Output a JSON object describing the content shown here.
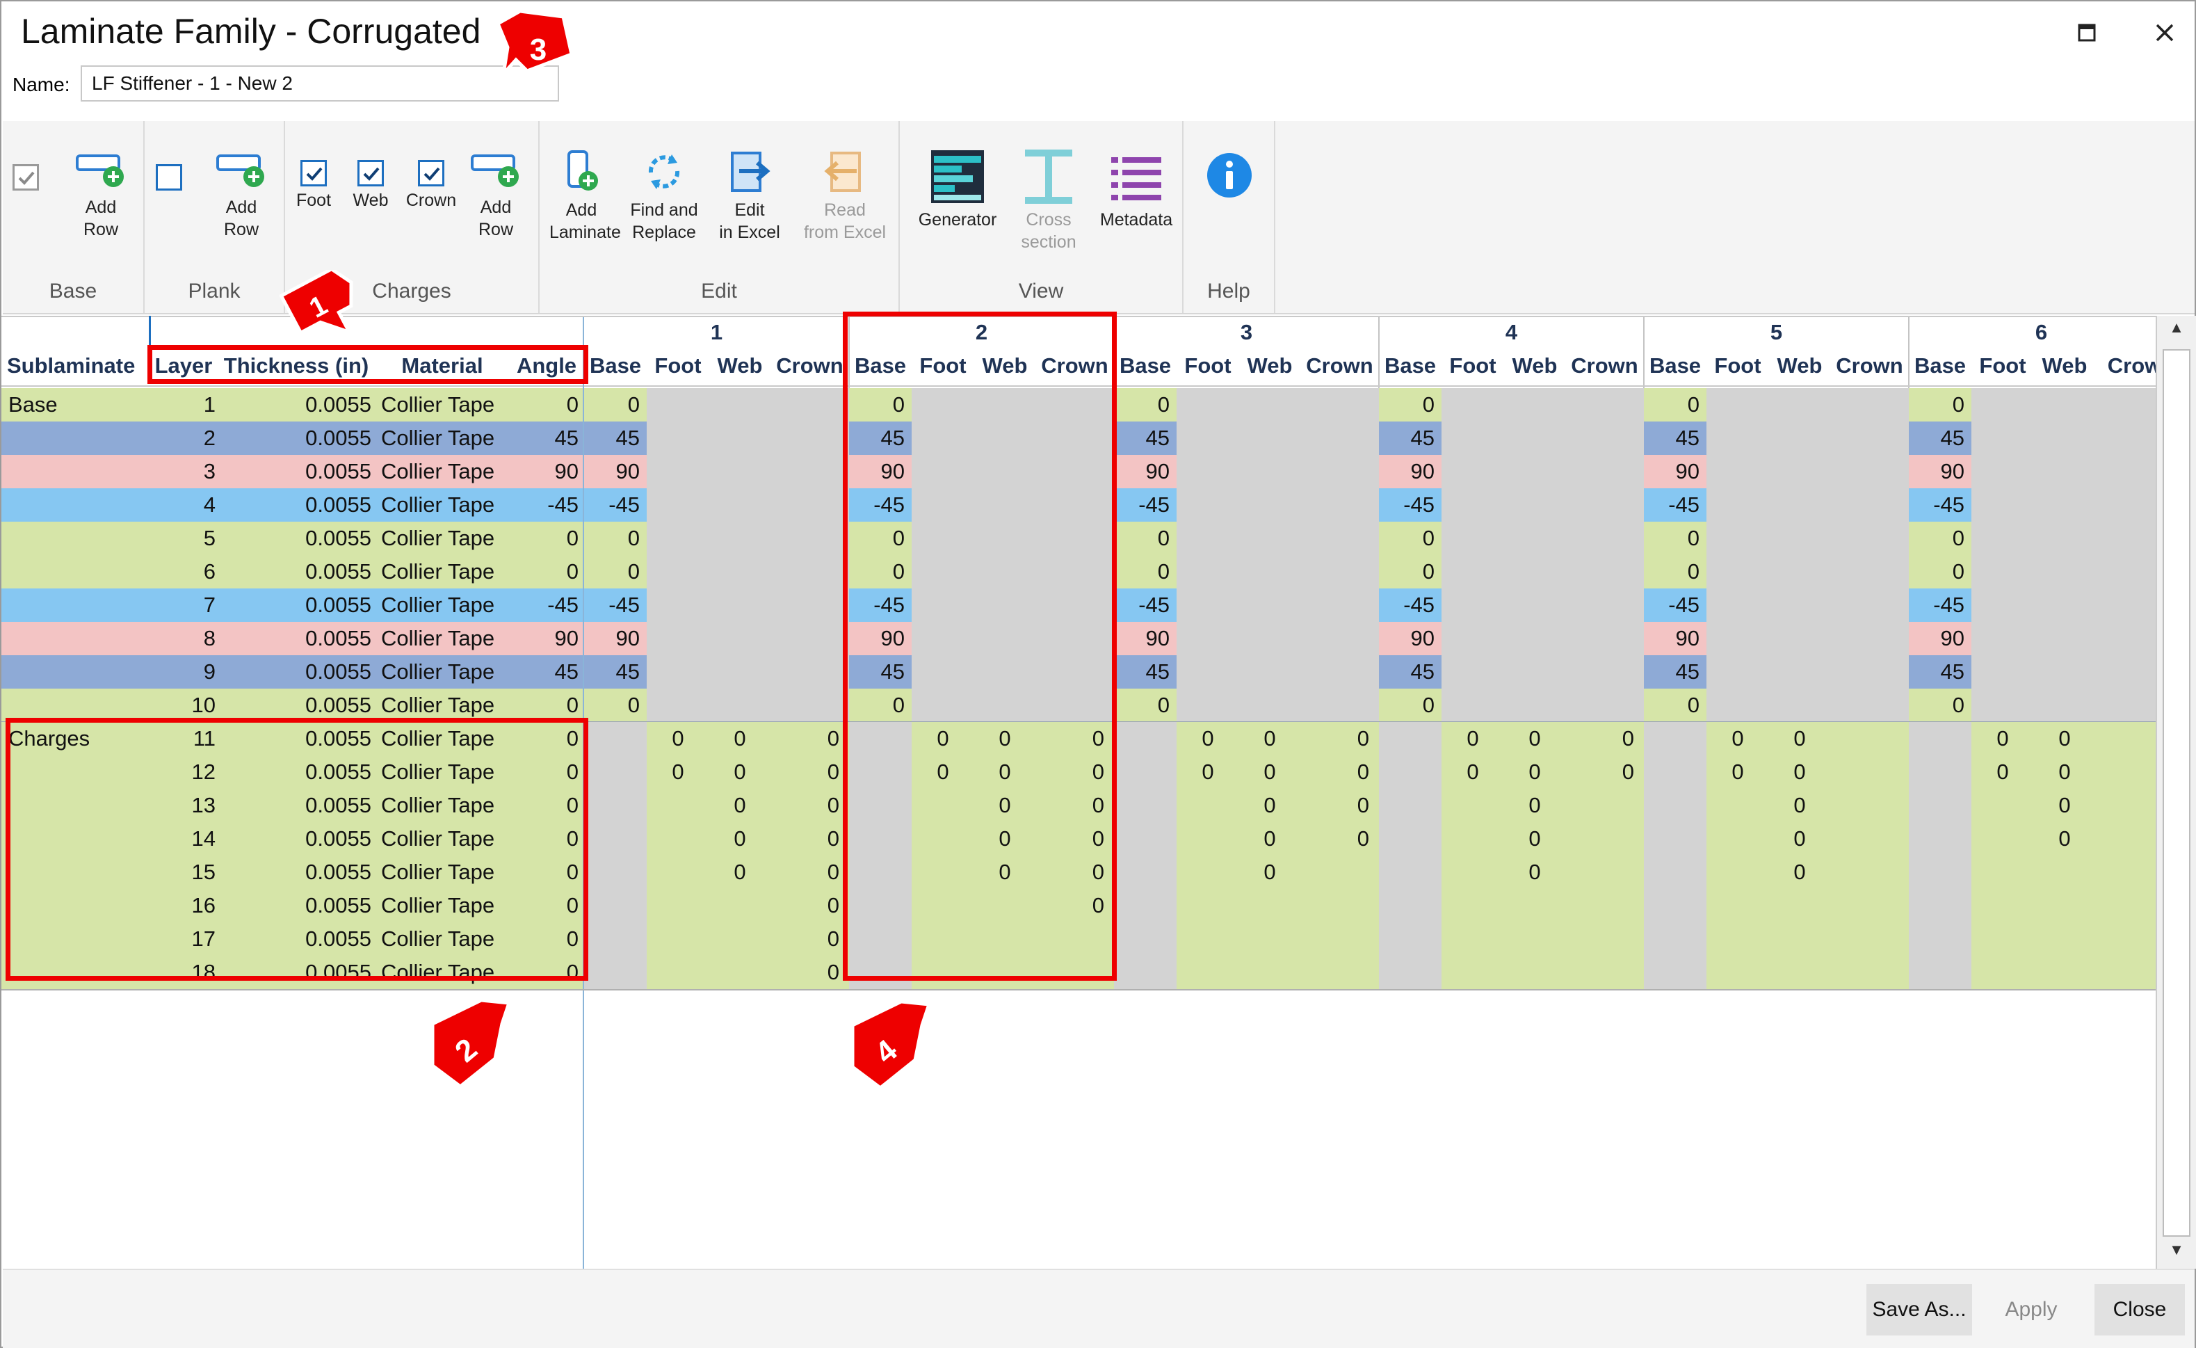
{
  "window": {
    "title": "Laminate Family - Corrugated",
    "name_label": "Name:",
    "name_value": "LF Stiffener - 1 - New 2"
  },
  "ribbon": {
    "groups": {
      "base": "Base",
      "plank": "Plank",
      "charges": "Charges",
      "edit": "Edit",
      "view": "View",
      "help": "Help"
    },
    "base_add_row": [
      "Add",
      "Row"
    ],
    "plank_add_row": [
      "Add",
      "Row"
    ],
    "charges_foot": "Foot",
    "charges_web": "Web",
    "charges_crown": "Crown",
    "charges_add_row": [
      "Add",
      "Row"
    ],
    "add_laminate": [
      "Add",
      "Laminate"
    ],
    "find_replace": [
      "Find and",
      "Replace"
    ],
    "edit_excel": [
      "Edit",
      "in Excel"
    ],
    "read_excel": [
      "Read",
      "from Excel"
    ],
    "generator": "Generator",
    "cross_section": [
      "Cross",
      "section"
    ],
    "metadata": "Metadata"
  },
  "grid": {
    "left_headers": [
      "Sublaminate",
      "Layer",
      "Thickness (in)",
      "Material",
      "Angle"
    ],
    "group_numbers": [
      "1",
      "2",
      "3",
      "4",
      "5",
      "6"
    ],
    "sub_headers": [
      "Base",
      "Foot",
      "Web",
      "Crown"
    ],
    "last_sub_headers": [
      "Base",
      "Foot",
      "Web",
      "Crow"
    ],
    "sublaminates": {
      "base": "Base",
      "charges": "Charges"
    },
    "base_rows": [
      {
        "layer": "1",
        "thickness": "0.0055",
        "material": "Collier Tape",
        "angle": "0"
      },
      {
        "layer": "2",
        "thickness": "0.0055",
        "material": "Collier Tape",
        "angle": "45"
      },
      {
        "layer": "3",
        "thickness": "0.0055",
        "material": "Collier Tape",
        "angle": "90"
      },
      {
        "layer": "4",
        "thickness": "0.0055",
        "material": "Collier Tape",
        "angle": "-45"
      },
      {
        "layer": "5",
        "thickness": "0.0055",
        "material": "Collier Tape",
        "angle": "0"
      },
      {
        "layer": "6",
        "thickness": "0.0055",
        "material": "Collier Tape",
        "angle": "0"
      },
      {
        "layer": "7",
        "thickness": "0.0055",
        "material": "Collier Tape",
        "angle": "-45"
      },
      {
        "layer": "8",
        "thickness": "0.0055",
        "material": "Collier Tape",
        "angle": "90"
      },
      {
        "layer": "9",
        "thickness": "0.0055",
        "material": "Collier Tape",
        "angle": "45"
      },
      {
        "layer": "10",
        "thickness": "0.0055",
        "material": "Collier Tape",
        "angle": "0"
      }
    ],
    "charge_rows": [
      {
        "layer": "11",
        "thickness": "0.0055",
        "material": "Collier Tape",
        "angle": "0"
      },
      {
        "layer": "12",
        "thickness": "0.0055",
        "material": "Collier Tape",
        "angle": "0"
      },
      {
        "layer": "13",
        "thickness": "0.0055",
        "material": "Collier Tape",
        "angle": "0"
      },
      {
        "layer": "14",
        "thickness": "0.0055",
        "material": "Collier Tape",
        "angle": "0"
      },
      {
        "layer": "15",
        "thickness": "0.0055",
        "material": "Collier Tape",
        "angle": "0"
      },
      {
        "layer": "16",
        "thickness": "0.0055",
        "material": "Collier Tape",
        "angle": "0"
      },
      {
        "layer": "17",
        "thickness": "0.0055",
        "material": "Collier Tape",
        "angle": "0"
      },
      {
        "layer": "18",
        "thickness": "0.0055",
        "material": "Collier Tape",
        "angle": "0"
      }
    ],
    "charge_cells": [
      [
        [
          "0",
          "0",
          "0"
        ],
        [
          "0",
          "0",
          "0"
        ],
        [
          "0",
          "0",
          "0"
        ],
        [
          "0",
          "0",
          "0"
        ],
        [
          "0",
          "0",
          ""
        ],
        [
          "0",
          "0",
          ""
        ]
      ],
      [
        [
          "0",
          "0",
          "0"
        ],
        [
          "0",
          "0",
          "0"
        ],
        [
          "0",
          "0",
          "0"
        ],
        [
          "0",
          "0",
          "0"
        ],
        [
          "0",
          "0",
          ""
        ],
        [
          "0",
          "0",
          ""
        ]
      ],
      [
        [
          "",
          "0",
          "0"
        ],
        [
          "",
          "0",
          "0"
        ],
        [
          "",
          "0",
          "0"
        ],
        [
          "",
          "0",
          ""
        ],
        [
          "",
          "0",
          ""
        ],
        [
          "",
          "0",
          ""
        ]
      ],
      [
        [
          "",
          "0",
          "0"
        ],
        [
          "",
          "0",
          "0"
        ],
        [
          "",
          "0",
          "0"
        ],
        [
          "",
          "0",
          ""
        ],
        [
          "",
          "0",
          ""
        ],
        [
          "",
          "0",
          ""
        ]
      ],
      [
        [
          "",
          "0",
          "0"
        ],
        [
          "",
          "0",
          "0"
        ],
        [
          "",
          "0",
          ""
        ],
        [
          "",
          "0",
          ""
        ],
        [
          "",
          "0",
          ""
        ],
        [
          "",
          "",
          ""
        ]
      ],
      [
        [
          "",
          "",
          "0"
        ],
        [
          "",
          "",
          "0"
        ],
        [
          "",
          "",
          ""
        ],
        [
          "",
          "",
          ""
        ],
        [
          "",
          "",
          ""
        ],
        [
          "",
          "",
          ""
        ]
      ],
      [
        [
          "",
          "",
          "0"
        ],
        [
          "",
          "",
          ""
        ],
        [
          "",
          "",
          ""
        ],
        [
          "",
          "",
          ""
        ],
        [
          "",
          "",
          ""
        ],
        [
          "",
          "",
          ""
        ]
      ],
      [
        [
          "",
          "",
          "0"
        ],
        [
          "",
          "",
          ""
        ],
        [
          "",
          "",
          ""
        ],
        [
          "",
          "",
          ""
        ],
        [
          "",
          "",
          ""
        ],
        [
          "",
          "",
          ""
        ]
      ]
    ],
    "angle_colors": {
      "0": "#d6e5a8",
      "45": "#8eaad6",
      "90": "#f3c4c4",
      "-45": "#86c7f2"
    }
  },
  "footer": {
    "save_as": "Save As...",
    "apply": "Apply",
    "close": "Close"
  },
  "annotations": [
    "1",
    "2",
    "3",
    "4"
  ]
}
